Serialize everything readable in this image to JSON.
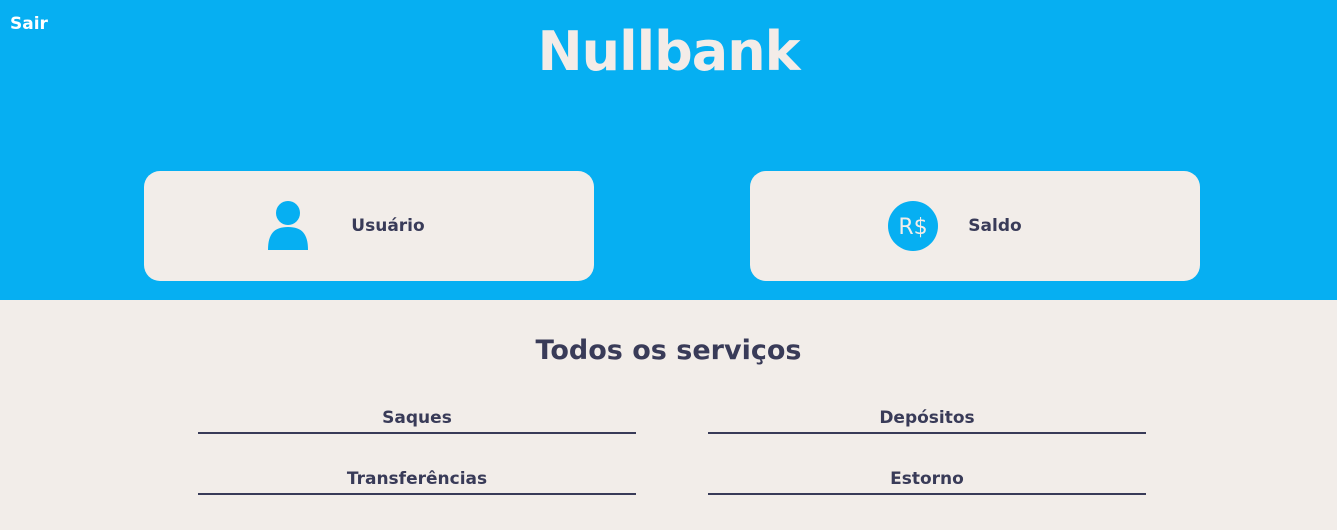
{
  "header": {
    "logout_label": "Sair",
    "brand": "Nullbank"
  },
  "cards": {
    "user": {
      "label": "Usuário",
      "icon": "user-icon"
    },
    "balance": {
      "label": "Saldo",
      "icon": "currency-real-icon",
      "icon_text": "R$"
    }
  },
  "services": {
    "title": "Todos os serviços",
    "items": [
      {
        "label": "Saques"
      },
      {
        "label": "Depósitos"
      },
      {
        "label": "Transferências"
      },
      {
        "label": "Estorno"
      }
    ]
  },
  "colors": {
    "primary": "#06aff2",
    "background": "#f2ede9",
    "text": "#393b58"
  }
}
